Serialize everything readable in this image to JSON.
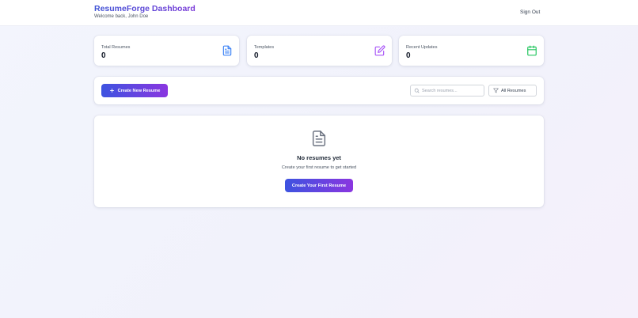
{
  "header": {
    "title": "ResumeForge Dashboard",
    "welcome": "Welcome back, John Doe",
    "signout_label": "Sign Out"
  },
  "stats": [
    {
      "label": "Total Resumes",
      "value": "0",
      "icon": "document-icon",
      "color": "#3b82f6"
    },
    {
      "label": "Templates",
      "value": "0",
      "icon": "edit-icon",
      "color": "#a855f7"
    },
    {
      "label": "Recent Updates",
      "value": "0",
      "icon": "calendar-icon",
      "color": "#22c55e"
    }
  ],
  "toolbar": {
    "create_label": "Create New Resume",
    "search_placeholder": "Search resumes...",
    "filter_label": "All Resumes"
  },
  "empty_state": {
    "icon": "document-icon",
    "title": "No resumes yet",
    "subtitle": "Create your first resume to get started",
    "button_label": "Create Your First Resume"
  },
  "colors": {
    "accent_start": "#3d53e0",
    "accent_end": "#8a36e0"
  }
}
